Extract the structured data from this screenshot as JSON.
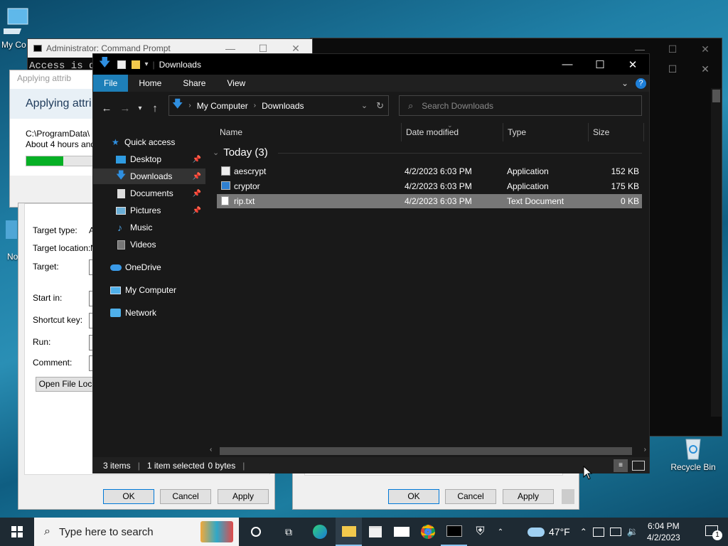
{
  "desktop": {
    "icons": [
      {
        "label": "My Co"
      },
      {
        "label": "No"
      },
      {
        "label": "Recycle Bin"
      }
    ]
  },
  "cmd_window": {
    "title": "Administrator: Command Prompt",
    "text": "Access is de"
  },
  "attr_dialog": {
    "title": "Applying attrib",
    "heading": "Applying attri",
    "path": "C:\\ProgramData\\",
    "time": "About 4 hours and",
    "progress": 0.5
  },
  "props_dialog": {
    "labels": [
      "Target type:",
      "Target location:",
      "Target:",
      "Start in:",
      "Shortcut key:",
      "Run:",
      "Comment:"
    ],
    "target_type_value": "A",
    "target_location_value": "N",
    "open_file_location": "Open File Loc",
    "ok": "OK",
    "cancel": "Cancel",
    "apply": "Apply"
  },
  "props_dialog2": {
    "ok": "OK",
    "cancel": "Cancel",
    "apply": "Apply"
  },
  "explorer": {
    "title": "Downloads",
    "ribbon_tabs": [
      "File",
      "Home",
      "Share",
      "View"
    ],
    "breadcrumb": [
      "My Computer",
      "Downloads"
    ],
    "search_placeholder": "Search Downloads",
    "nav": {
      "quick_access": "Quick access",
      "desktop": "Desktop",
      "downloads": "Downloads",
      "documents": "Documents",
      "pictures": "Pictures",
      "music": "Music",
      "videos": "Videos",
      "onedrive": "OneDrive",
      "my_computer": "My Computer",
      "network": "Network"
    },
    "columns": [
      "Name",
      "Date modified",
      "Type",
      "Size"
    ],
    "group_label": "Today (3)",
    "files": [
      {
        "name": "aescrypt",
        "date": "4/2/2023 6:03 PM",
        "type": "Application",
        "size": "152 KB"
      },
      {
        "name": "cryptor",
        "date": "4/2/2023 6:03 PM",
        "type": "Application",
        "size": "175 KB"
      },
      {
        "name": "rip.txt",
        "date": "4/2/2023 6:03 PM",
        "type": "Text Document",
        "size": "0 KB"
      }
    ],
    "status": {
      "items": "3 items",
      "selected": "1 item selected",
      "bytes": "0 bytes"
    }
  },
  "taskbar": {
    "search_placeholder": "Type here to search",
    "weather": "47°F",
    "time": "6:04 PM",
    "date": "4/2/2023",
    "notifications": "1"
  },
  "colors": {
    "accent": "#1e7fb8",
    "progress": "#06b025"
  }
}
